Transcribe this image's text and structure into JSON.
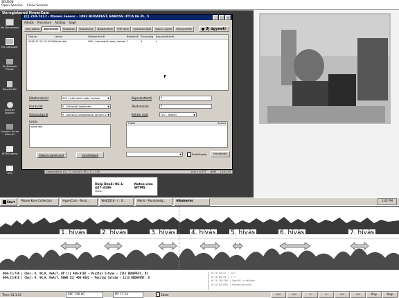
{
  "top_menu": {
    "title": "SESSION",
    "items": [
      "Open Session",
      "Close Session"
    ]
  },
  "hypercam_title": "Unregistered HyperCam",
  "desktop_icons": [
    {
      "label": "My Documents",
      "icon": "folder-icon"
    },
    {
      "label": "My Computer",
      "icon": "computer-icon"
    },
    {
      "label": "My Network Places",
      "icon": "network-icon"
    },
    {
      "label": "Recycle Bin",
      "icon": "recycle-bin-icon"
    },
    {
      "label": "Internet Explorer",
      "icon": "browser-icon"
    },
    {
      "label": "Connect to the Internet",
      "icon": "connect-icon"
    },
    {
      "label": "WTMS demo",
      "icon": "app-icon"
    },
    {
      "label": "GSS",
      "icon": "app-icon"
    }
  ],
  "crm_window": {
    "title": "[C] 210-7417 - Mareni Ferenc - 1082 BUDAPEST, BAROSS UTCA 86 PL. 5",
    "menu": [
      "Adatok",
      "Procedure",
      "Adatlap",
      "Súgó"
    ],
    "tabs": [
      "Jegy adatai",
      "Bejelentés",
      "Feladatok",
      "Visszahívás",
      "Naptárnézet",
      "TMS lezár",
      "Operátornapló",
      "Kapcs. ügyek",
      "Feljegyzések"
    ],
    "new_ticket_label": "Új ügynek!",
    "table_headers": [
      "Dátum",
      "Leírás",
      "Hibaleírás/cél",
      "Bejelentő",
      "Súlyosság",
      "Kapcsolattartó"
    ],
    "table_rows": [
      [
        "2000.11.20 12:43:06",
        "lövés felé",
        "999 - információ adás, lezárás",
        "1",
        "9",
        "n"
      ]
    ],
    "form": {
      "hiba_label": "Hibaforrás/cél",
      "hiba_value": "999 - információ adás, lezárás",
      "forras_label": "Forrás/cél",
      "forras_value": "9 - Előfizetői bejelentés",
      "sulyossag_label": "Súlyosság/cél",
      "sulyossag_value": "9 - Alacsony szolgáltatási szinten ü...",
      "kapcs_label": "Kapcsolattartó",
      "kapcs_value": "9",
      "telefon_label": "Telefonszám",
      "telefon_value": "9",
      "eleres_label": "Elérési mód",
      "eleres_value": "TEL - Telefon",
      "leiras_label": "Leírás",
      "leiras_value": "lövés felé",
      "hibak_label": "Hibák",
      "eszlelt_label": "Észlelt",
      "eszleles_label": "Észlelésgép",
      "hozzaadas_label": "Hozzáadás",
      "btn_hiba": "Hibajel-regisztráció",
      "btn_lehetoseg": "Lehetőségek"
    },
    "status": {
      "connection": "connected to 10.1.77.402:002 ORS 10.1.7:05",
      "line": "Line 5 CuTST",
      "num": "NUM",
      "time": "13:42:39"
    }
  },
  "helpdesk": {
    "line1": "Help Desk: 06-1-447-3186",
    "line2": "Notes-cím: WTMS",
    "line3": "Vision"
  },
  "taskbar": {
    "start_label": "Start",
    "tasks": [
      "Mouse Keys Collection",
      "HyperCam - Reco...",
      "Web5016 - ( : 0...",
      "Menü - Munkamég...",
      "Hibabeírés"
    ],
    "clock": "1:42 PM"
  },
  "waveform": {
    "calls": [
      "1. hívás",
      "2. hívás",
      "3. hívás",
      "4. hívás",
      "5. hívás",
      "6. hívás",
      "7. hívás"
    ]
  },
  "log": {
    "lines": [
      "004:21:736 | Char: K, VK_K, NoALT, UP    [1] 466-0182 - Pusztai István - 1113 BUDAPEST, DI",
      "004:21:916 | Char: K, VK_K, NoALT, DOWN  [1] 466-0182 - Pusztai István - 1113 BUDAPEST, D"
    ],
    "side_lines": [
      "0:11:03:47 | CCC",
      "0:11:03:45 | n n",
      "0:11:30:250 | Ügyfél probléma",
      "0:12:04:855 | Rendeléshívás"
    ]
  },
  "bottom_bar": {
    "time": "Time: 01:1:15",
    "fields": [
      "RPF: 706.00",
      "PP: 11.14"
    ],
    "zoom_label": "Zoom",
    "buttons": [
      "<<",
      "<<",
      "<",
      ">",
      ">>",
      ">>",
      "Play",
      "Stop"
    ]
  }
}
